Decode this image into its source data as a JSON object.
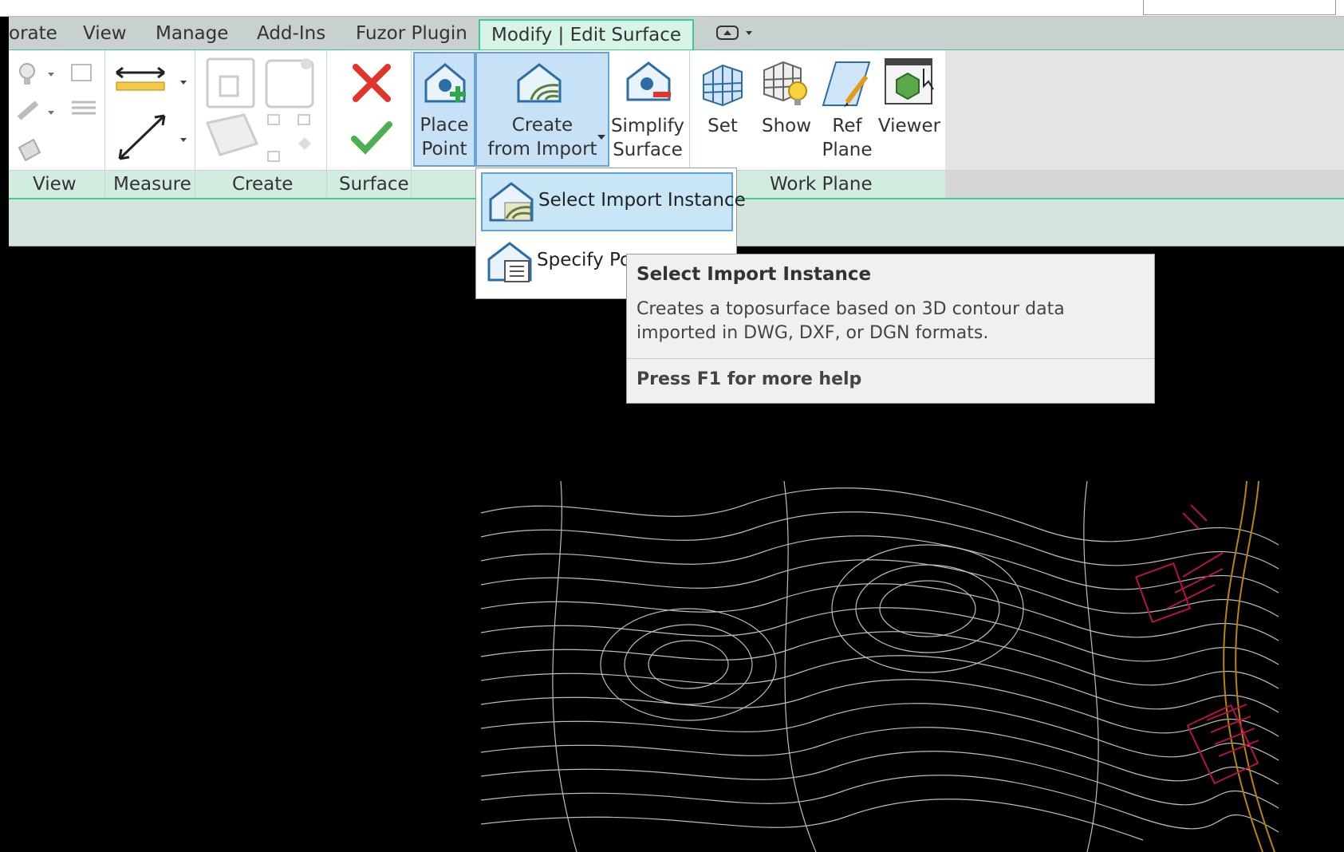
{
  "ribbon": {
    "tabs": [
      {
        "label": "orate"
      },
      {
        "label": "View"
      },
      {
        "label": "Manage"
      },
      {
        "label": "Add-Ins"
      },
      {
        "label": "Fuzor Plugin"
      },
      {
        "label": "Modify | Edit Surface",
        "active": true
      }
    ],
    "groups": {
      "view": "View",
      "measure": "Measure",
      "create": "Create",
      "surface": "Surface",
      "work_plane": "Work Plane"
    },
    "buttons": {
      "place_point": [
        "Place",
        "Point"
      ],
      "create_from_import": [
        "Create",
        "from Import"
      ],
      "simplify_surface": [
        "Simplify",
        "Surface"
      ],
      "set": "Set",
      "show": "Show",
      "ref_plane": [
        "Ref",
        "Plane"
      ],
      "viewer": "Viewer"
    }
  },
  "dropdown": {
    "items": [
      {
        "label": "Select Import Instance",
        "highlighted": true
      },
      {
        "label": "Specify Po"
      }
    ]
  },
  "tooltip": {
    "title": "Select Import Instance",
    "body": "Creates a toposurface based on 3D contour data imported in DWG, DXF, or DGN formats.",
    "help": "Press F1 for more help"
  },
  "colors": {
    "accent": "#3ec995",
    "selection": "#c7e2f6",
    "cancel": "#e0352b",
    "confirm": "#4caf50"
  }
}
